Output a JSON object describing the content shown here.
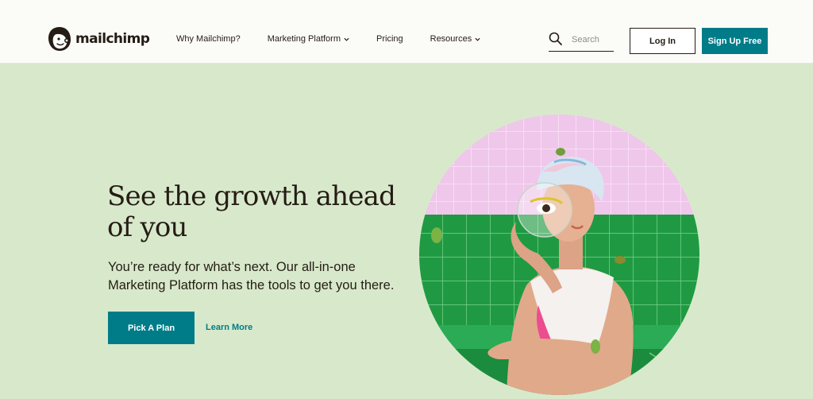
{
  "brand": {
    "name": "mailchimp"
  },
  "nav": {
    "items": [
      {
        "label": "Why Mailchimp?",
        "has_dropdown": false
      },
      {
        "label": "Marketing Platform",
        "has_dropdown": true
      },
      {
        "label": "Pricing",
        "has_dropdown": false
      },
      {
        "label": "Resources",
        "has_dropdown": true
      }
    ]
  },
  "search": {
    "placeholder": "Search",
    "value": ""
  },
  "header_buttons": {
    "login": "Log In",
    "signup": "Sign Up Free"
  },
  "hero": {
    "title": "See the growth ahead of you",
    "subtitle": "You’re ready for what’s next. Our all-in-one Marketing Platform has the tools to get you there.",
    "primary_cta": "Pick A Plan",
    "secondary_cta": "Learn More"
  },
  "colors": {
    "background": "#d8e9cb",
    "header_bg": "#fbfbf7",
    "accent": "#007c89",
    "text": "#241c15"
  },
  "icons": [
    "freddie-logo-icon",
    "chevron-down-icon",
    "search-icon"
  ]
}
